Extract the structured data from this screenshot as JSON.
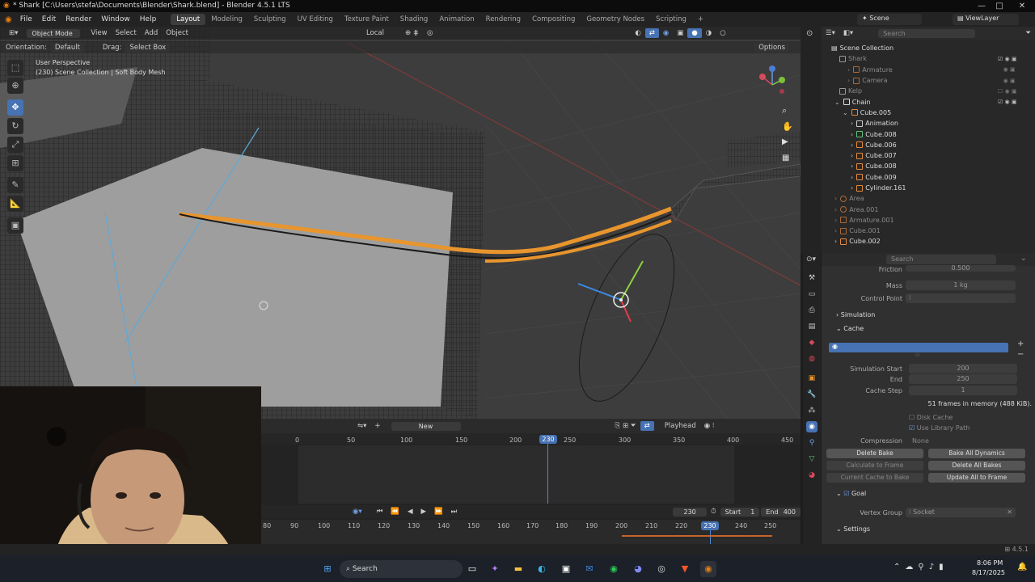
{
  "window": {
    "title": "* Shark [C:\\Users\\stefa\\Documents\\Blender\\Shark.blend] - Blender 4.5.1 LTS"
  },
  "menu": [
    "File",
    "Edit",
    "Render",
    "Window",
    "Help"
  ],
  "workspaces": [
    "Layout",
    "Modeling",
    "Sculpting",
    "UV Editing",
    "Texture Paint",
    "Shading",
    "Animation",
    "Rendering",
    "Compositing",
    "Geometry Nodes",
    "Scripting"
  ],
  "scene": {
    "name": "Scene",
    "view_layer": "ViewLayer"
  },
  "viewport_header": {
    "mode": "Object Mode",
    "view": "View",
    "select": "Select",
    "add": "Add",
    "object": "Object",
    "pivot": "Local"
  },
  "tool_settings": {
    "orientation_label": "Orientation:",
    "orientation": "Default",
    "drag_label": "Drag:",
    "drag": "Select Box",
    "options": "Options"
  },
  "viewport": {
    "perspective": "User Perspective",
    "info": "(230) Scene Collection | Soft Body Mesh"
  },
  "outliner": {
    "search_placeholder": "Search",
    "root": "Scene Collection",
    "rows": [
      {
        "name": "Shark",
        "dim": true
      },
      {
        "name": "Armature",
        "dim": true
      },
      {
        "name": "Camera",
        "dim": true
      },
      {
        "name": "Kelp",
        "dim": true
      },
      {
        "name": "Chain",
        "dim": false
      },
      {
        "name": "Cube.005",
        "dim": false
      },
      {
        "name": "Animation",
        "dim": false
      },
      {
        "name": "Cube.008",
        "dim": false
      },
      {
        "name": "Cube.006",
        "dim": false
      },
      {
        "name": "Cube.007",
        "dim": false
      },
      {
        "name": "Cube.008",
        "dim": false
      },
      {
        "name": "Cube.009",
        "dim": false
      },
      {
        "name": "Cylinder.161",
        "dim": false
      },
      {
        "name": "Area",
        "dim": true
      },
      {
        "name": "Area.001",
        "dim": true
      },
      {
        "name": "Armature.001",
        "dim": true
      },
      {
        "name": "Cube.001",
        "dim": true
      },
      {
        "name": "Cube.002",
        "dim": false
      }
    ]
  },
  "properties": {
    "search_placeholder": "Search",
    "friction_label": "Friction",
    "friction": "0.500",
    "mass_label": "Mass",
    "mass": "1 kg",
    "control_point_label": "Control Point",
    "simulation": "Simulation",
    "cache": "Cache",
    "sim_start_label": "Simulation Start",
    "sim_start": "200",
    "end_label": "End",
    "end": "250",
    "cache_step_label": "Cache Step",
    "cache_step": "1",
    "memory": "51 frames in memory (488 KiB).",
    "disk_cache": "Disk Cache",
    "use_library_path": "Use Library Path",
    "compression_label": "Compression",
    "compression": "None",
    "delete_bake": "Delete Bake",
    "bake_all": "Bake All Dynamics",
    "calculate_to_frame": "Calculate to Frame",
    "delete_all_bakes": "Delete All Bakes",
    "current_cache_to_bake": "Current Cache to Bake",
    "update_all_to_frame": "Update All to Frame",
    "goal": "Goal",
    "vertex_group_label": "Vertex Group",
    "vertex_group": "Socket",
    "settings": "Settings"
  },
  "timeline": {
    "new_label": "New",
    "playhead_label": "Playhead",
    "ticks": [
      "0",
      "50",
      "100",
      "150",
      "200",
      "250",
      "300",
      "350",
      "400",
      "450"
    ],
    "current_frame": "230",
    "start_label": "Start",
    "start": "1",
    "end_label": "End",
    "end": "400",
    "ticks2": [
      "80",
      "90",
      "100",
      "110",
      "120",
      "130",
      "140",
      "150",
      "160",
      "170",
      "180",
      "190",
      "200",
      "210",
      "220",
      "240",
      "250"
    ]
  },
  "status": {
    "version": "4.5.1"
  },
  "taskbar": {
    "search_placeholder": "Search",
    "time": "8:06 PM",
    "date": "8/17/2025"
  }
}
